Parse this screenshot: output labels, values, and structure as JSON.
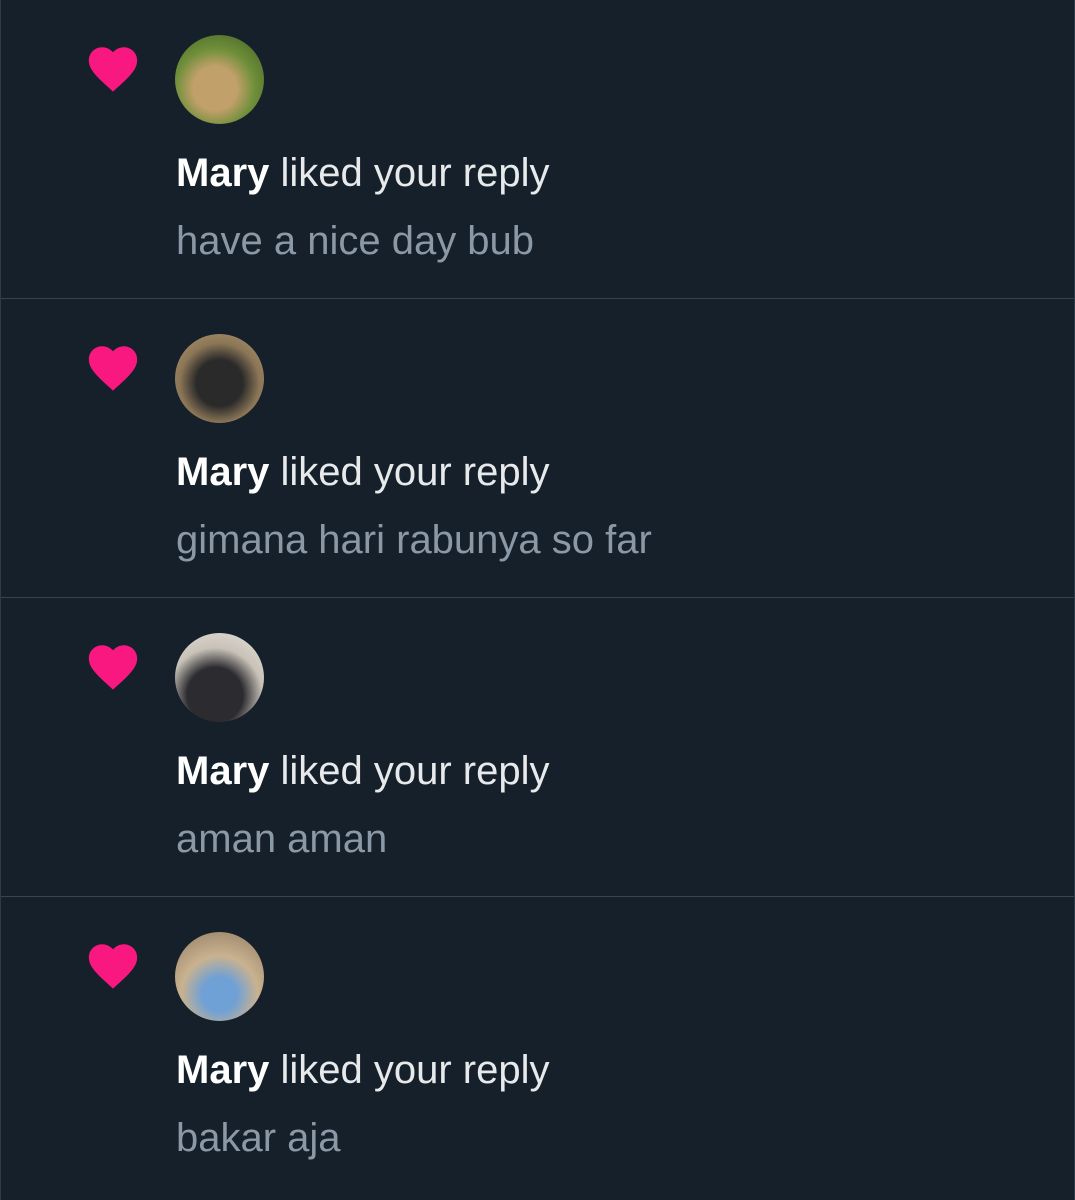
{
  "colors": {
    "background": "#15202b",
    "heart": "#f91880",
    "primary_text": "#e7e9ea",
    "secondary_text": "#8b98a5",
    "divider": "#38444d"
  },
  "notifications": [
    {
      "icon": "heart-icon",
      "user": "Mary",
      "action": " liked your reply",
      "reply_text": "have a nice day bub"
    },
    {
      "icon": "heart-icon",
      "user": "Mary",
      "action": " liked your reply",
      "reply_text": "gimana hari rabunya so far"
    },
    {
      "icon": "heart-icon",
      "user": "Mary",
      "action": " liked your reply",
      "reply_text": "aman aman"
    },
    {
      "icon": "heart-icon",
      "user": "Mary",
      "action": " liked your reply",
      "reply_text": "bakar aja"
    }
  ]
}
